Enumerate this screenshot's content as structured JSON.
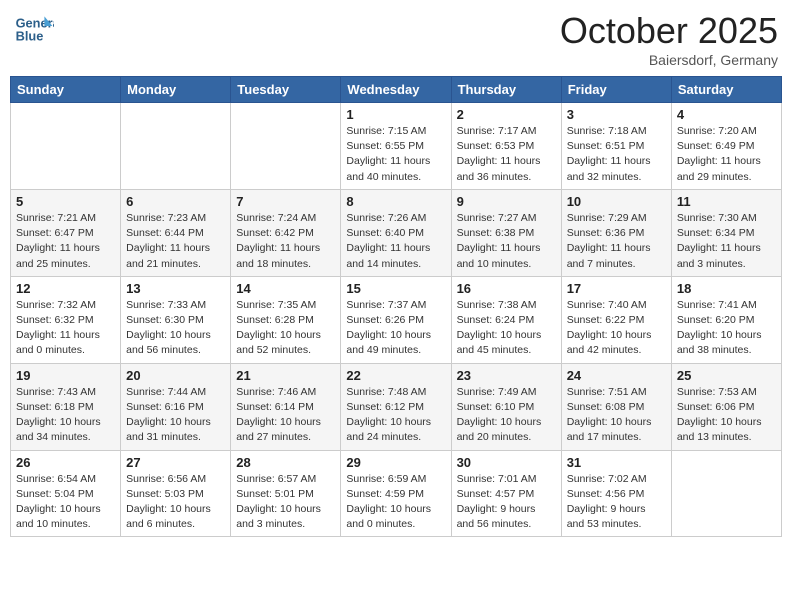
{
  "header": {
    "logo_line1": "General",
    "logo_line2": "Blue",
    "month": "October 2025",
    "location": "Baiersdorf, Germany"
  },
  "weekdays": [
    "Sunday",
    "Monday",
    "Tuesday",
    "Wednesday",
    "Thursday",
    "Friday",
    "Saturday"
  ],
  "weeks": [
    [
      {
        "day": null,
        "info": null
      },
      {
        "day": null,
        "info": null
      },
      {
        "day": null,
        "info": null
      },
      {
        "day": "1",
        "info": "Sunrise: 7:15 AM\nSunset: 6:55 PM\nDaylight: 11 hours\nand 40 minutes."
      },
      {
        "day": "2",
        "info": "Sunrise: 7:17 AM\nSunset: 6:53 PM\nDaylight: 11 hours\nand 36 minutes."
      },
      {
        "day": "3",
        "info": "Sunrise: 7:18 AM\nSunset: 6:51 PM\nDaylight: 11 hours\nand 32 minutes."
      },
      {
        "day": "4",
        "info": "Sunrise: 7:20 AM\nSunset: 6:49 PM\nDaylight: 11 hours\nand 29 minutes."
      }
    ],
    [
      {
        "day": "5",
        "info": "Sunrise: 7:21 AM\nSunset: 6:47 PM\nDaylight: 11 hours\nand 25 minutes."
      },
      {
        "day": "6",
        "info": "Sunrise: 7:23 AM\nSunset: 6:44 PM\nDaylight: 11 hours\nand 21 minutes."
      },
      {
        "day": "7",
        "info": "Sunrise: 7:24 AM\nSunset: 6:42 PM\nDaylight: 11 hours\nand 18 minutes."
      },
      {
        "day": "8",
        "info": "Sunrise: 7:26 AM\nSunset: 6:40 PM\nDaylight: 11 hours\nand 14 minutes."
      },
      {
        "day": "9",
        "info": "Sunrise: 7:27 AM\nSunset: 6:38 PM\nDaylight: 11 hours\nand 10 minutes."
      },
      {
        "day": "10",
        "info": "Sunrise: 7:29 AM\nSunset: 6:36 PM\nDaylight: 11 hours\nand 7 minutes."
      },
      {
        "day": "11",
        "info": "Sunrise: 7:30 AM\nSunset: 6:34 PM\nDaylight: 11 hours\nand 3 minutes."
      }
    ],
    [
      {
        "day": "12",
        "info": "Sunrise: 7:32 AM\nSunset: 6:32 PM\nDaylight: 11 hours\nand 0 minutes."
      },
      {
        "day": "13",
        "info": "Sunrise: 7:33 AM\nSunset: 6:30 PM\nDaylight: 10 hours\nand 56 minutes."
      },
      {
        "day": "14",
        "info": "Sunrise: 7:35 AM\nSunset: 6:28 PM\nDaylight: 10 hours\nand 52 minutes."
      },
      {
        "day": "15",
        "info": "Sunrise: 7:37 AM\nSunset: 6:26 PM\nDaylight: 10 hours\nand 49 minutes."
      },
      {
        "day": "16",
        "info": "Sunrise: 7:38 AM\nSunset: 6:24 PM\nDaylight: 10 hours\nand 45 minutes."
      },
      {
        "day": "17",
        "info": "Sunrise: 7:40 AM\nSunset: 6:22 PM\nDaylight: 10 hours\nand 42 minutes."
      },
      {
        "day": "18",
        "info": "Sunrise: 7:41 AM\nSunset: 6:20 PM\nDaylight: 10 hours\nand 38 minutes."
      }
    ],
    [
      {
        "day": "19",
        "info": "Sunrise: 7:43 AM\nSunset: 6:18 PM\nDaylight: 10 hours\nand 34 minutes."
      },
      {
        "day": "20",
        "info": "Sunrise: 7:44 AM\nSunset: 6:16 PM\nDaylight: 10 hours\nand 31 minutes."
      },
      {
        "day": "21",
        "info": "Sunrise: 7:46 AM\nSunset: 6:14 PM\nDaylight: 10 hours\nand 27 minutes."
      },
      {
        "day": "22",
        "info": "Sunrise: 7:48 AM\nSunset: 6:12 PM\nDaylight: 10 hours\nand 24 minutes."
      },
      {
        "day": "23",
        "info": "Sunrise: 7:49 AM\nSunset: 6:10 PM\nDaylight: 10 hours\nand 20 minutes."
      },
      {
        "day": "24",
        "info": "Sunrise: 7:51 AM\nSunset: 6:08 PM\nDaylight: 10 hours\nand 17 minutes."
      },
      {
        "day": "25",
        "info": "Sunrise: 7:53 AM\nSunset: 6:06 PM\nDaylight: 10 hours\nand 13 minutes."
      }
    ],
    [
      {
        "day": "26",
        "info": "Sunrise: 6:54 AM\nSunset: 5:04 PM\nDaylight: 10 hours\nand 10 minutes."
      },
      {
        "day": "27",
        "info": "Sunrise: 6:56 AM\nSunset: 5:03 PM\nDaylight: 10 hours\nand 6 minutes."
      },
      {
        "day": "28",
        "info": "Sunrise: 6:57 AM\nSunset: 5:01 PM\nDaylight: 10 hours\nand 3 minutes."
      },
      {
        "day": "29",
        "info": "Sunrise: 6:59 AM\nSunset: 4:59 PM\nDaylight: 10 hours\nand 0 minutes."
      },
      {
        "day": "30",
        "info": "Sunrise: 7:01 AM\nSunset: 4:57 PM\nDaylight: 9 hours\nand 56 minutes."
      },
      {
        "day": "31",
        "info": "Sunrise: 7:02 AM\nSunset: 4:56 PM\nDaylight: 9 hours\nand 53 minutes."
      },
      {
        "day": null,
        "info": null
      }
    ]
  ]
}
